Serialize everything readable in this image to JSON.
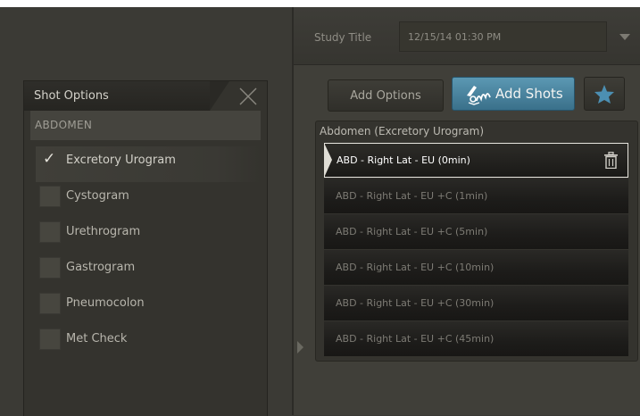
{
  "shot_options": {
    "title": "Shot Options",
    "category": "ABDOMEN",
    "items": [
      {
        "label": "Excretory Urogram",
        "checked": true
      },
      {
        "label": "Cystogram",
        "checked": false
      },
      {
        "label": "Urethrogram",
        "checked": false
      },
      {
        "label": "Gastrogram",
        "checked": false
      },
      {
        "label": "Pneumocolon",
        "checked": false
      },
      {
        "label": "Met Check",
        "checked": false
      }
    ]
  },
  "study": {
    "title_label": "Study Title",
    "title_value": "12/15/14 01:30 PM"
  },
  "buttons": {
    "add_options": "Add Options",
    "add_shots": "Add Shots"
  },
  "shots": {
    "header": "Abdomen (Excretory Urogram)",
    "rows": [
      "ABD - Right Lat - EU (0min)",
      "ABD - Right Lat - EU +C (1min)",
      "ABD - Right Lat - EU +C (5min)",
      "ABD - Right Lat - EU +C (10min)",
      "ABD - Right Lat - EU +C (30min)",
      "ABD - Right Lat - EU +C (45min)"
    ]
  },
  "colors": {
    "accent": "#4a88a6",
    "background": "#3b3a35",
    "selected_border": "#e8e6df"
  },
  "icons": [
    "close-icon",
    "check-icon",
    "dropdown-icon",
    "xray-icon",
    "star-icon",
    "trash-icon",
    "expand-arrow-icon"
  ]
}
